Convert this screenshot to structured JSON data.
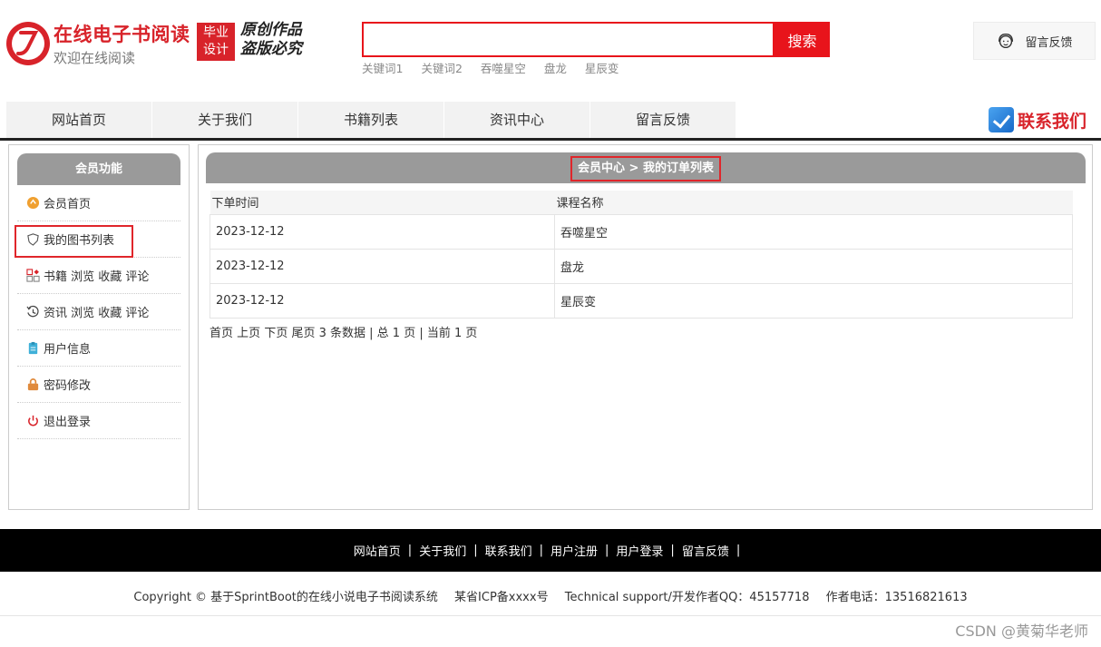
{
  "header": {
    "site_title": "在线电子书阅读",
    "site_subtitle": "欢迎在线阅读",
    "badge_line1": "毕业",
    "badge_line2": "设计",
    "slogan_line1": "原创作品",
    "slogan_line2": "盗版必究",
    "search_value": "",
    "search_button": "搜索",
    "hot_words": [
      "关键词1",
      "关键词2",
      "吞噬星空",
      "盘龙",
      "星辰变"
    ],
    "feedback_label": "留言反馈"
  },
  "nav": {
    "items": [
      "网站首页",
      "关于我们",
      "书籍列表",
      "资讯中心",
      "留言反馈"
    ],
    "contact_label": "联系我们"
  },
  "sidebar": {
    "title": "会员功能",
    "items": [
      {
        "label": "会员首页",
        "icon": "member-home-icon"
      },
      {
        "label": "我的图书列表",
        "icon": "book-shield-icon"
      },
      {
        "label": "书籍 浏览 收藏 评论",
        "icon": "grid-icon"
      },
      {
        "label": "资讯 浏览 收藏 评论",
        "icon": "clock-refresh-icon"
      },
      {
        "label": "用户信息",
        "icon": "clipboard-icon"
      },
      {
        "label": "密码修改",
        "icon": "lock-icon"
      },
      {
        "label": "退出登录",
        "icon": "power-icon"
      }
    ]
  },
  "main": {
    "breadcrumb": "会员中心 > 我的订单列表",
    "columns": [
      "下单时间",
      "课程名称"
    ],
    "rows": [
      [
        "2023-12-12",
        "吞噬星空"
      ],
      [
        "2023-12-12",
        "盘龙"
      ],
      [
        "2023-12-12",
        "星辰变"
      ]
    ],
    "pager": {
      "first": "首页",
      "prev": "上页",
      "next": "下页",
      "last": "尾页",
      "summary": "3 条数据 | 总 1 页 | 当前 1 页"
    }
  },
  "footer": {
    "links": [
      "网站首页",
      "关于我们",
      "联系我们",
      "用户注册",
      "用户登录",
      "留言反馈"
    ],
    "copyright": "Copyright © 基于SprintBoot的在线小说电子书阅读系统",
    "icp": "某省ICP备xxxx号",
    "support": "Technical support/开发作者QQ：45157718",
    "phone": "作者电话：13516821613",
    "watermark": "CSDN @黄菊华老师"
  },
  "colors": {
    "brand_red": "#d8232a",
    "search_red": "#e8141b",
    "panel_gray": "#9a9a9a"
  }
}
